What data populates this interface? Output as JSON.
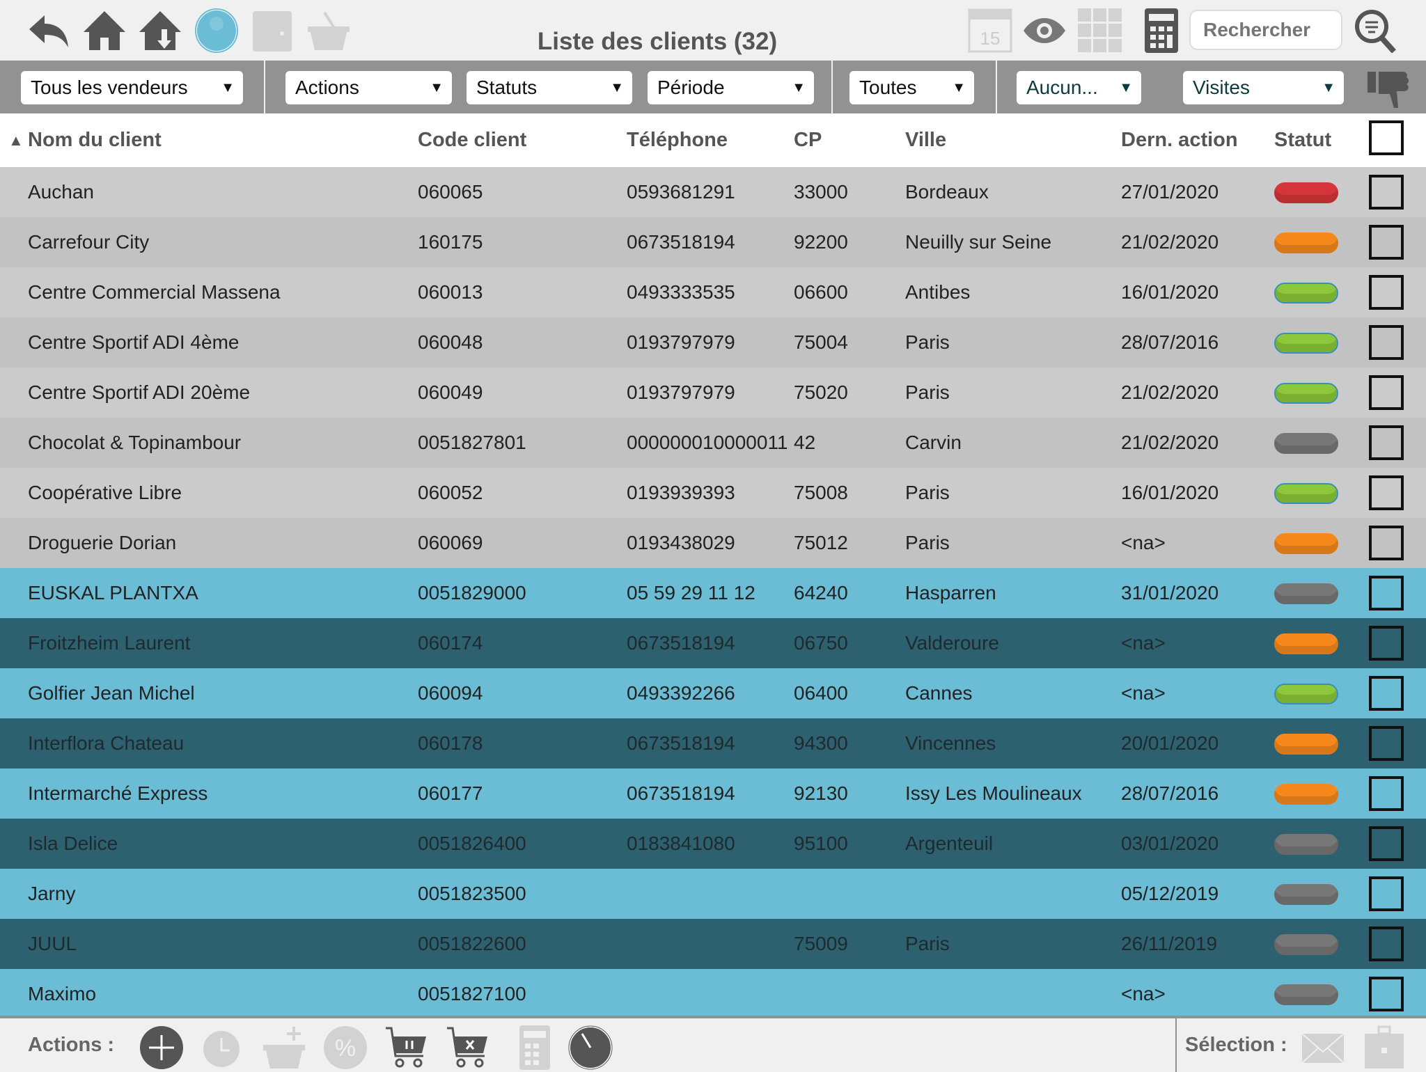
{
  "header": {
    "title": "Liste des clients (32)",
    "search_placeholder": "Rechercher"
  },
  "toolbar_icons": [
    "back-icon",
    "home-icon",
    "home-download-icon",
    "user-icon",
    "wallet-icon",
    "basket-icon",
    "calendar-icon",
    "eye-icon",
    "grid-icon",
    "calculator-icon",
    "search-filter-icon"
  ],
  "calendar_day": "15",
  "filters": [
    {
      "label": "Tous les vendeurs"
    },
    {
      "label": "Actions"
    },
    {
      "label": "Statuts"
    },
    {
      "label": "Période"
    },
    {
      "label": "Toutes"
    },
    {
      "label": "Aucun..."
    },
    {
      "label": "Visites"
    }
  ],
  "columns": {
    "name": "Nom du client",
    "code": "Code client",
    "tel": "Téléphone",
    "cp": "CP",
    "ville": "Ville",
    "dern": "Dern. action",
    "statut": "Statut",
    "sort_indicator": "▲"
  },
  "status_colors": {
    "red": "#d4353a",
    "orange": "#f7891c",
    "green": "#8cc83a",
    "gray": "#777777"
  },
  "row_colors": {
    "light_a": "#cbcbcb",
    "light_b": "#c2c2c2",
    "blue": "#6bbcd5",
    "teal": "#2e6170"
  },
  "rows": [
    {
      "name": "Auchan",
      "code": "060065",
      "tel": "0593681291",
      "cp": "33000",
      "ville": "Bordeaux",
      "dern": "27/01/2020",
      "status": "red",
      "bg": "light_a"
    },
    {
      "name": "Carrefour City",
      "code": "160175",
      "tel": "0673518194",
      "cp": "92200",
      "ville": "Neuilly sur Seine",
      "dern": "21/02/2020",
      "status": "orange",
      "bg": "light_b"
    },
    {
      "name": "Centre Commercial Massena",
      "code": "060013",
      "tel": "0493333535",
      "cp": "06600",
      "ville": "Antibes",
      "dern": "16/01/2020",
      "status": "green",
      "bg": "light_a"
    },
    {
      "name": "Centre Sportif ADI 4ème",
      "code": "060048",
      "tel": "0193797979",
      "cp": "75004",
      "ville": "Paris",
      "dern": "28/07/2016",
      "status": "green",
      "bg": "light_b"
    },
    {
      "name": "Centre Sportif ADI 20ème",
      "code": "060049",
      "tel": "0193797979",
      "cp": "75020",
      "ville": "Paris",
      "dern": "21/02/2020",
      "status": "green",
      "bg": "light_a"
    },
    {
      "name": "Chocolat & Topinambour",
      "code": "0051827801",
      "tel": "000000010000011",
      "cp": "42",
      "ville": "Carvin",
      "dern": "21/02/2020",
      "status": "gray",
      "bg": "light_b"
    },
    {
      "name": "Coopérative Libre",
      "code": "060052",
      "tel": "0193939393",
      "cp": "75008",
      "ville": "Paris",
      "dern": "16/01/2020",
      "status": "green",
      "bg": "light_a"
    },
    {
      "name": "Droguerie Dorian",
      "code": "060069",
      "tel": "0193438029",
      "cp": "75012",
      "ville": "Paris",
      "dern": "<na>",
      "status": "orange",
      "bg": "light_b"
    },
    {
      "name": "EUSKAL PLANTXA",
      "code": "0051829000",
      "tel": "05 59 29 11 12",
      "cp": "64240",
      "ville": "Hasparren",
      "dern": "31/01/2020",
      "status": "gray",
      "bg": "blue"
    },
    {
      "name": "Froitzheim Laurent",
      "code": "060174",
      "tel": "0673518194",
      "cp": "06750",
      "ville": "Valderoure",
      "dern": "<na>",
      "status": "orange",
      "bg": "teal"
    },
    {
      "name": "Golfier Jean Michel",
      "code": "060094",
      "tel": "0493392266",
      "cp": "06400",
      "ville": "Cannes",
      "dern": "<na>",
      "status": "green",
      "bg": "blue"
    },
    {
      "name": "Interflora Chateau",
      "code": "060178",
      "tel": "0673518194",
      "cp": "94300",
      "ville": "Vincennes",
      "dern": "20/01/2020",
      "status": "orange",
      "bg": "teal"
    },
    {
      "name": "Intermarché Express",
      "code": "060177",
      "tel": "0673518194",
      "cp": "92130",
      "ville": "Issy Les Moulineaux",
      "dern": "28/07/2016",
      "status": "orange",
      "bg": "blue"
    },
    {
      "name": "Isla Delice",
      "code": "0051826400",
      "tel": "0183841080",
      "cp": "95100",
      "ville": "Argenteuil",
      "dern": "03/01/2020",
      "status": "gray",
      "bg": "teal"
    },
    {
      "name": "Jarny",
      "code": "0051823500",
      "tel": "",
      "cp": "",
      "ville": "",
      "dern": "05/12/2019",
      "status": "gray",
      "bg": "blue"
    },
    {
      "name": "JUUL",
      "code": "0051822600",
      "tel": "",
      "cp": "75009",
      "ville": "Paris",
      "dern": "26/11/2019",
      "status": "gray",
      "bg": "teal"
    },
    {
      "name": "Maximo",
      "code": "0051827100",
      "tel": "",
      "cp": "",
      "ville": "",
      "dern": "<na>",
      "status": "gray",
      "bg": "blue"
    }
  ],
  "bottom": {
    "actions_label": "Actions :",
    "selection_label": "Sélection :",
    "action_icons": [
      "add-icon",
      "alarm-icon",
      "basket-add-icon",
      "percent-icon",
      "cart-pause-icon",
      "cart-cancel-icon",
      "calculator-icon",
      "clock-icon"
    ],
    "selection_icons": [
      "mail-icon",
      "briefcase-icon"
    ]
  }
}
